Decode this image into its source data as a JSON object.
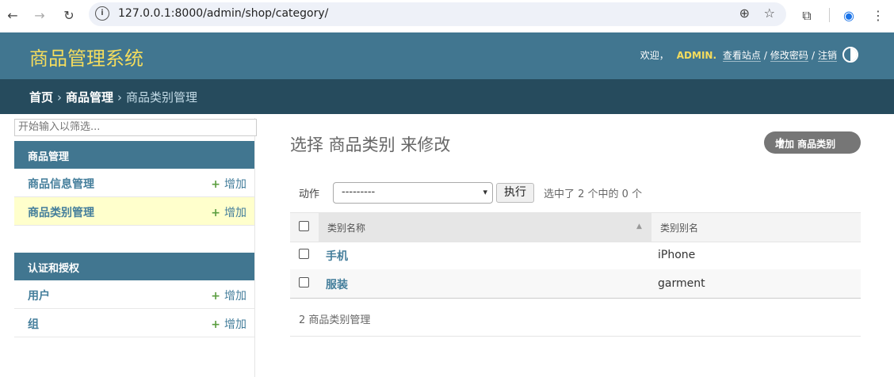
{
  "browser": {
    "url": "127.0.0.1:8000/admin/shop/category/"
  },
  "header": {
    "branding": "商品管理系统",
    "welcome": "欢迎，",
    "username": "ADMIN.",
    "view_site": "查看站点",
    "change_password": "修改密码",
    "logout": "注销",
    "separator": "/"
  },
  "breadcrumbs": {
    "home": "首页",
    "app": "商品管理",
    "current": "商品类别管理",
    "separator": "›"
  },
  "sidebar": {
    "filter_placeholder": "开始输入以筛选...",
    "modules": [
      {
        "title": "商品管理",
        "items": [
          {
            "name": "商品信息管理",
            "add_label": "增加",
            "selected": false
          },
          {
            "name": "商品类别管理",
            "add_label": "增加",
            "selected": true
          }
        ]
      },
      {
        "title": "认证和授权",
        "items": [
          {
            "name": "用户",
            "add_label": "增加",
            "selected": false
          },
          {
            "name": "组",
            "add_label": "增加",
            "selected": false
          }
        ]
      }
    ]
  },
  "main": {
    "title": "选择 商品类别 来修改",
    "add_button": "增加 商品类别",
    "actions_label": "动作",
    "action_selected": "---------",
    "go_button": "执行",
    "selection_count": "选中了 2 个中的 0 个",
    "columns": [
      "类别名称",
      "类别别名"
    ],
    "rows": [
      {
        "name": "手机",
        "alias": "iPhone"
      },
      {
        "name": "服装",
        "alias": "garment"
      }
    ],
    "paginator": "2 商品类别管理"
  },
  "colors": {
    "header_bg": "#417690",
    "breadcrumb_bg": "#264b5d",
    "branding": "#f5dd5d",
    "link": "#447e9b",
    "add_icon": "#5b9e40",
    "selected_row": "#ffffcc"
  },
  "icons": [
    "back-arrow-icon",
    "forward-arrow-icon",
    "reload-icon",
    "info-icon",
    "zoom-icon",
    "star-icon",
    "extension-icon",
    "profile-icon",
    "menu-dots-icon",
    "theme-toggle-icon",
    "plus-icon",
    "sort-asc-icon",
    "chevron-down-icon"
  ]
}
